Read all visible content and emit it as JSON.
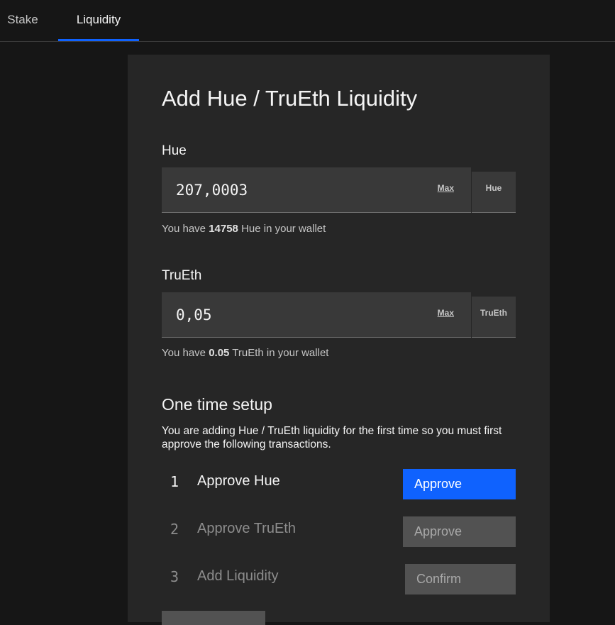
{
  "tabs": [
    {
      "label": "Stake",
      "active": false
    },
    {
      "label": "Liquidity",
      "active": true
    }
  ],
  "colors": {
    "accent": "#0f62fe",
    "background": "#161616",
    "panel": "#262626",
    "field": "#393939"
  },
  "panel": {
    "title": "Add Hue / TruEth Liquidity",
    "fields": [
      {
        "label": "Hue",
        "value": "207,0003",
        "max_label": "Max",
        "unit": "Hue",
        "helper_prefix": "You have ",
        "helper_amount": "14758",
        "helper_suffix": " Hue in your wallet"
      },
      {
        "label": "TruEth",
        "value": "0,05",
        "max_label": "Max",
        "unit": "TruEth",
        "helper_prefix": "You have ",
        "helper_amount": "0.05",
        "helper_suffix": " TruEth in your wallet"
      }
    ],
    "setup": {
      "title": "One time setup",
      "description": "You are adding Hue / TruEth liquidity for the first time so you must first approve the following transactions.",
      "steps": [
        {
          "number": "1",
          "label": "Approve Hue",
          "button": "Approve",
          "state": "active"
        },
        {
          "number": "2",
          "label": "Approve TruEth",
          "button": "Approve",
          "state": "disabled"
        },
        {
          "number": "3",
          "label": "Add Liquidity",
          "button": "Confirm",
          "state": "disabled"
        }
      ]
    }
  }
}
